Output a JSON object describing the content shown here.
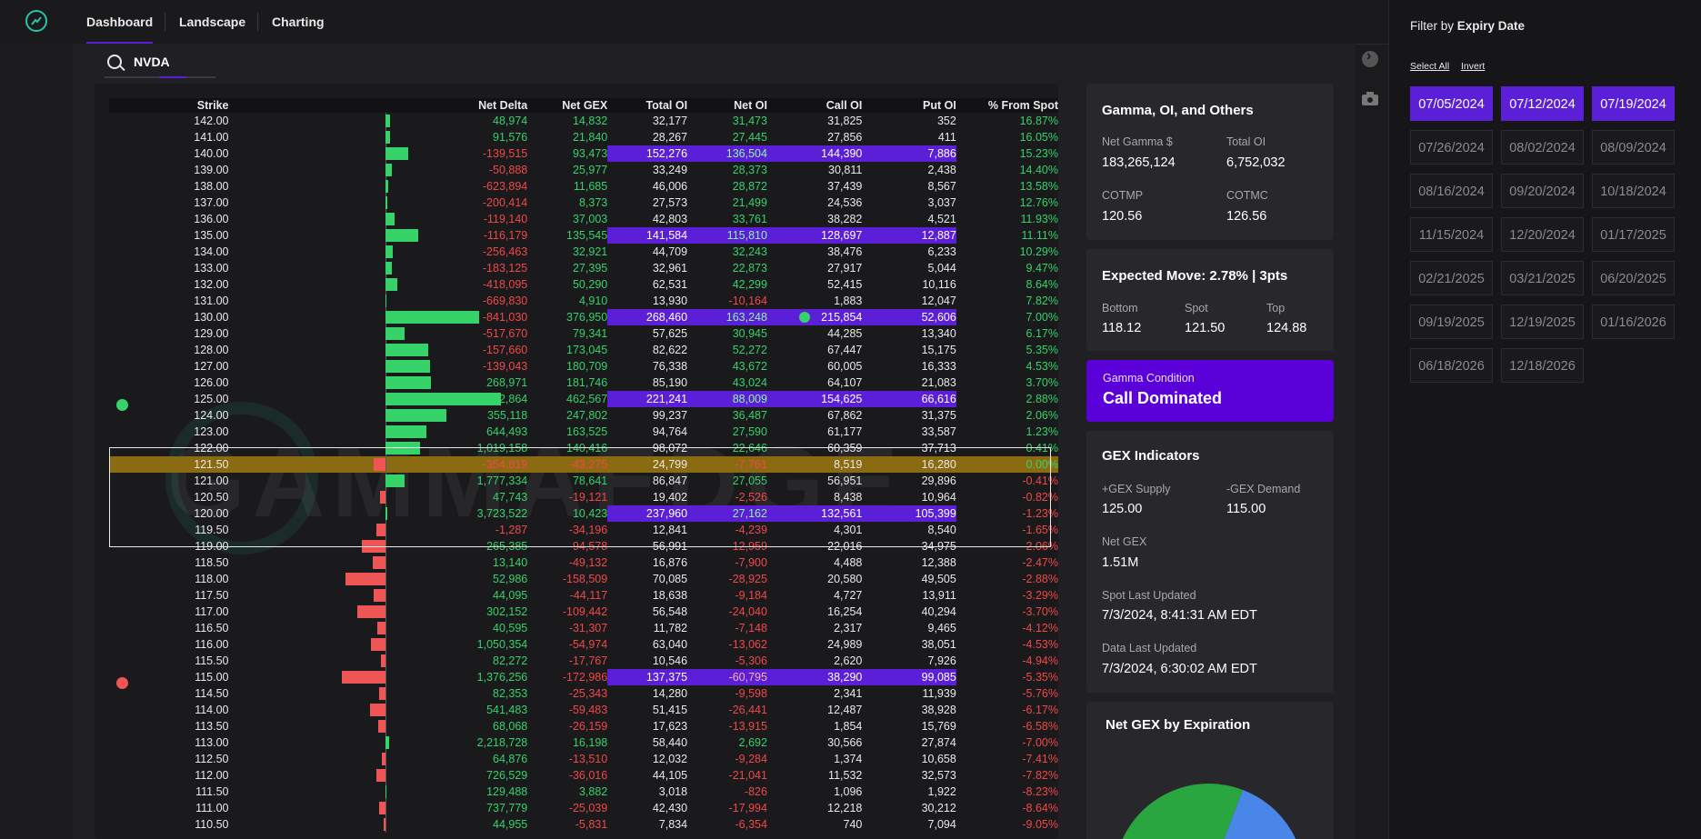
{
  "nav": {
    "tabs": [
      "Dashboard",
      "Landscape",
      "Charting"
    ]
  },
  "search": {
    "value": "NVDA"
  },
  "table": {
    "headers": [
      "Strike",
      "Net Delta",
      "Net GEX",
      "Total OI",
      "Net OI",
      "Call OI",
      "Put OI",
      "% From Spot"
    ],
    "rows": [
      {
        "strike": "142.00",
        "nd": "48,974",
        "ng": "14,832",
        "toi": "32,177",
        "noi": "31,473",
        "coi": "31,825",
        "poi": "352",
        "pct": "16.87%",
        "bar": 0.04,
        "hl": false
      },
      {
        "strike": "141.00",
        "nd": "91,576",
        "ng": "21,840",
        "toi": "28,267",
        "noi": "27,445",
        "coi": "27,856",
        "poi": "411",
        "pct": "16.05%",
        "bar": 0.045,
        "hl": false
      },
      {
        "strike": "140.00",
        "nd": "-139,515",
        "ng": "93,473",
        "toi": "152,276",
        "noi": "136,504",
        "coi": "144,390",
        "poi": "7,886",
        "pct": "15.23%",
        "bar": 0.2,
        "hl": true
      },
      {
        "strike": "139.00",
        "nd": "-50,888",
        "ng": "25,977",
        "toi": "33,249",
        "noi": "28,373",
        "coi": "30,811",
        "poi": "2,438",
        "pct": "14.40%",
        "bar": 0.055,
        "hl": false
      },
      {
        "strike": "138.00",
        "nd": "-623,894",
        "ng": "11,685",
        "toi": "46,006",
        "noi": "28,872",
        "coi": "37,439",
        "poi": "8,567",
        "pct": "13.58%",
        "bar": 0.025,
        "hl": false
      },
      {
        "strike": "137.00",
        "nd": "-200,414",
        "ng": "8,373",
        "toi": "27,573",
        "noi": "21,499",
        "coi": "24,536",
        "poi": "3,037",
        "pct": "12.76%",
        "bar": 0.018,
        "hl": false
      },
      {
        "strike": "136.00",
        "nd": "-119,140",
        "ng": "37,003",
        "toi": "42,803",
        "noi": "33,761",
        "coi": "38,282",
        "poi": "4,521",
        "pct": "11.93%",
        "bar": 0.08,
        "hl": false
      },
      {
        "strike": "135.00",
        "nd": "-116,179",
        "ng": "135,545",
        "toi": "141,584",
        "noi": "115,810",
        "coi": "128,697",
        "poi": "12,887",
        "pct": "11.11%",
        "bar": 0.29,
        "hl": true
      },
      {
        "strike": "134.00",
        "nd": "-256,463",
        "ng": "32,921",
        "toi": "44,709",
        "noi": "32,243",
        "coi": "38,476",
        "poi": "6,233",
        "pct": "10.29%",
        "bar": 0.07,
        "hl": false
      },
      {
        "strike": "133.00",
        "nd": "-183,125",
        "ng": "27,395",
        "toi": "32,961",
        "noi": "22,873",
        "coi": "27,917",
        "poi": "5,044",
        "pct": "9.47%",
        "bar": 0.06,
        "hl": false
      },
      {
        "strike": "132.00",
        "nd": "-418,095",
        "ng": "50,290",
        "toi": "62,531",
        "noi": "42,299",
        "coi": "52,415",
        "poi": "10,116",
        "pct": "8.64%",
        "bar": 0.11,
        "hl": false
      },
      {
        "strike": "131.00",
        "nd": "-669,830",
        "ng": "4,910",
        "toi": "13,930",
        "noi": "-10,164",
        "coi": "1,883",
        "poi": "12,047",
        "pct": "7.82%",
        "bar": 0.012,
        "hl": false
      },
      {
        "strike": "130.00",
        "nd": "-841,030",
        "ng": "376,950",
        "toi": "268,460",
        "noi": "163,248",
        "coi": "215,854",
        "poi": "52,606",
        "pct": "7.00%",
        "bar": 0.815,
        "hl": true,
        "calldot": true
      },
      {
        "strike": "129.00",
        "nd": "-517,670",
        "ng": "79,341",
        "toi": "57,625",
        "noi": "30,945",
        "coi": "44,285",
        "poi": "13,340",
        "pct": "6.17%",
        "bar": 0.17,
        "hl": false
      },
      {
        "strike": "128.00",
        "nd": "-157,660",
        "ng": "173,045",
        "toi": "82,622",
        "noi": "52,272",
        "coi": "67,447",
        "poi": "15,175",
        "pct": "5.35%",
        "bar": 0.375,
        "hl": false
      },
      {
        "strike": "127.00",
        "nd": "-139,043",
        "ng": "180,709",
        "toi": "76,338",
        "noi": "43,672",
        "coi": "60,005",
        "poi": "16,333",
        "pct": "4.53%",
        "bar": 0.39,
        "hl": false
      },
      {
        "strike": "126.00",
        "nd": "268,971",
        "ng": "181,746",
        "toi": "85,190",
        "noi": "43,024",
        "coi": "64,107",
        "poi": "21,083",
        "pct": "3.70%",
        "bar": 0.395,
        "hl": false
      },
      {
        "strike": "125.00",
        "nd": "452,864",
        "ng": "462,567",
        "toi": "221,241",
        "noi": "88,009",
        "coi": "154,625",
        "poi": "66,616",
        "pct": "2.88%",
        "bar": 1.0,
        "hl": true,
        "leftdot": "green"
      },
      {
        "strike": "124.00",
        "nd": "355,118",
        "ng": "247,802",
        "toi": "99,237",
        "noi": "36,487",
        "coi": "67,862",
        "poi": "31,375",
        "pct": "2.06%",
        "bar": 0.535,
        "hl": false
      },
      {
        "strike": "123.00",
        "nd": "644,493",
        "ng": "163,525",
        "toi": "94,764",
        "noi": "27,590",
        "coi": "61,177",
        "poi": "33,587",
        "pct": "1.23%",
        "bar": 0.355,
        "hl": false
      },
      {
        "strike": "122.00",
        "nd": "1,019,158",
        "ng": "140,416",
        "toi": "98,072",
        "noi": "22,646",
        "coi": "60,359",
        "poi": "37,713",
        "pct": "0.41%",
        "bar": 0.305,
        "hl": false
      },
      {
        "strike": "121.50",
        "nd": "-354,819",
        "ng": "-43,275",
        "toi": "24,799",
        "noi": "-7,761",
        "coi": "8,519",
        "poi": "16,280",
        "pct": "0.00%",
        "bar": -0.095,
        "hl": false,
        "spot": true
      },
      {
        "strike": "121.00",
        "nd": "1,777,334",
        "ng": "78,641",
        "toi": "86,847",
        "noi": "27,055",
        "coi": "56,951",
        "poi": "29,896",
        "pct": "-0.41%",
        "bar": 0.17,
        "hl": false
      },
      {
        "strike": "120.50",
        "nd": "47,743",
        "ng": "-19,121",
        "toi": "19,402",
        "noi": "-2,526",
        "coi": "8,438",
        "poi": "10,964",
        "pct": "-0.82%",
        "bar": -0.04,
        "hl": false
      },
      {
        "strike": "120.00",
        "nd": "3,723,522",
        "ng": "10,423",
        "toi": "237,960",
        "noi": "27,162",
        "coi": "132,561",
        "poi": "105,399",
        "pct": "-1.23%",
        "bar": 0.022,
        "hl": true
      },
      {
        "strike": "119.50",
        "nd": "-1,287",
        "ng": "-34,196",
        "toi": "12,841",
        "noi": "-4,239",
        "coi": "4,301",
        "poi": "8,540",
        "pct": "-1.65%",
        "bar": -0.074,
        "hl": false
      },
      {
        "strike": "119.00",
        "nd": "265,385",
        "ng": "-94,578",
        "toi": "56,991",
        "noi": "-12,959",
        "coi": "22,016",
        "poi": "34,975",
        "pct": "-2.06%",
        "bar": -0.204,
        "hl": false
      },
      {
        "strike": "118.50",
        "nd": "13,140",
        "ng": "-49,132",
        "toi": "16,876",
        "noi": "-7,900",
        "coi": "4,488",
        "poi": "12,388",
        "pct": "-2.47%",
        "bar": -0.106,
        "hl": false
      },
      {
        "strike": "118.00",
        "nd": "52,986",
        "ng": "-158,509",
        "toi": "70,085",
        "noi": "-28,925",
        "coi": "20,580",
        "poi": "49,505",
        "pct": "-2.88%",
        "bar": -0.343,
        "hl": false
      },
      {
        "strike": "117.50",
        "nd": "44,095",
        "ng": "-44,117",
        "toi": "18,638",
        "noi": "-9,184",
        "coi": "4,727",
        "poi": "13,911",
        "pct": "-3.29%",
        "bar": -0.095,
        "hl": false
      },
      {
        "strike": "117.00",
        "nd": "302,152",
        "ng": "-109,442",
        "toi": "56,548",
        "noi": "-24,040",
        "coi": "16,254",
        "poi": "40,294",
        "pct": "-3.70%",
        "bar": -0.237,
        "hl": false
      },
      {
        "strike": "116.50",
        "nd": "40,595",
        "ng": "-31,307",
        "toi": "11,782",
        "noi": "-7,148",
        "coi": "2,317",
        "poi": "9,465",
        "pct": "-4.12%",
        "bar": -0.068,
        "hl": false
      },
      {
        "strike": "116.00",
        "nd": "1,050,354",
        "ng": "-54,974",
        "toi": "63,040",
        "noi": "-13,062",
        "coi": "24,989",
        "poi": "38,051",
        "pct": "-4.53%",
        "bar": -0.119,
        "hl": false
      },
      {
        "strike": "115.50",
        "nd": "82,272",
        "ng": "-17,767",
        "toi": "10,546",
        "noi": "-5,306",
        "coi": "2,620",
        "poi": "7,926",
        "pct": "-4.94%",
        "bar": -0.038,
        "hl": false
      },
      {
        "strike": "115.00",
        "nd": "1,376,256",
        "ng": "-172,986",
        "toi": "137,375",
        "noi": "-60,795",
        "coi": "38,290",
        "poi": "99,085",
        "pct": "-5.35%",
        "bar": -0.374,
        "hl": true,
        "leftdot": "red"
      },
      {
        "strike": "114.50",
        "nd": "82,353",
        "ng": "-25,343",
        "toi": "14,280",
        "noi": "-9,598",
        "coi": "2,341",
        "poi": "11,939",
        "pct": "-5.76%",
        "bar": -0.055,
        "hl": false
      },
      {
        "strike": "114.00",
        "nd": "541,483",
        "ng": "-59,483",
        "toi": "51,415",
        "noi": "-26,441",
        "coi": "12,487",
        "poi": "38,928",
        "pct": "-6.17%",
        "bar": -0.129,
        "hl": false
      },
      {
        "strike": "113.50",
        "nd": "68,068",
        "ng": "-26,159",
        "toi": "17,623",
        "noi": "-13,915",
        "coi": "1,854",
        "poi": "15,769",
        "pct": "-6.58%",
        "bar": -0.057,
        "hl": false
      },
      {
        "strike": "113.00",
        "nd": "2,218,728",
        "ng": "16,198",
        "toi": "58,440",
        "noi": "2,692",
        "coi": "30,566",
        "poi": "27,874",
        "pct": "-7.00%",
        "bar": 0.035,
        "hl": false
      },
      {
        "strike": "112.50",
        "nd": "64,876",
        "ng": "-13,510",
        "toi": "12,032",
        "noi": "-9,284",
        "coi": "1,374",
        "poi": "10,658",
        "pct": "-7.41%",
        "bar": -0.029,
        "hl": false
      },
      {
        "strike": "112.00",
        "nd": "726,529",
        "ng": "-36,016",
        "toi": "44,105",
        "noi": "-21,041",
        "coi": "11,532",
        "poi": "32,573",
        "pct": "-7.82%",
        "bar": -0.078,
        "hl": false
      },
      {
        "strike": "111.50",
        "nd": "129,488",
        "ng": "3,882",
        "toi": "3,018",
        "noi": "-826",
        "coi": "1,096",
        "poi": "1,922",
        "pct": "-8.23%",
        "bar": 0.008,
        "hl": false
      },
      {
        "strike": "111.00",
        "nd": "737,779",
        "ng": "-25,039",
        "toi": "42,430",
        "noi": "-17,994",
        "coi": "12,218",
        "poi": "30,212",
        "pct": "-8.64%",
        "bar": -0.054,
        "hl": false
      },
      {
        "strike": "110.50",
        "nd": "44,955",
        "ng": "-5,831",
        "toi": "7,834",
        "noi": "-6,354",
        "coi": "740",
        "poi": "7,094",
        "pct": "-9.05%",
        "bar": -0.013,
        "hl": false
      }
    ]
  },
  "watermark": "GAMMAEDGE",
  "cards": {
    "gamma": {
      "title": "Gamma, OI, and Others",
      "net_gamma_label": "Net Gamma $",
      "net_gamma": "183,265,124",
      "total_oi_label": "Total OI",
      "total_oi": "6,752,032",
      "cotmp_label": "COTMP",
      "cotmp": "120.56",
      "cotmc_label": "COTMC",
      "cotmc": "126.56"
    },
    "move": {
      "title": "Expected Move: 2.78% | 3pts",
      "bottom_label": "Bottom",
      "bottom": "118.12",
      "spot_label": "Spot",
      "spot": "121.50",
      "top_label": "Top",
      "top": "124.88"
    },
    "condition": {
      "label": "Gamma Condition",
      "value": "Call Dominated"
    },
    "gex": {
      "title": "GEX Indicators",
      "supply_label": "+GEX Supply",
      "supply": "125.00",
      "demand_label": "-GEX Demand",
      "demand": "115.00",
      "netgex_label": "Net GEX",
      "netgex": "1.51M",
      "spot_updated_label": "Spot Last Updated",
      "spot_updated": "7/3/2024, 8:41:31 AM EDT",
      "data_updated_label": "Data Last Updated",
      "data_updated": "7/3/2024, 6:30:02 AM EDT"
    },
    "pie": {
      "title": "Net GEX by Expiration"
    }
  },
  "filter": {
    "title_prefix": "Filter by ",
    "title_bold": "Expiry Date",
    "select_all": "Select All",
    "invert": "Invert",
    "dates": [
      {
        "d": "07/05/2024",
        "sel": true
      },
      {
        "d": "07/12/2024",
        "sel": true
      },
      {
        "d": "07/19/2024",
        "sel": true
      },
      {
        "d": "07/26/2024",
        "sel": false
      },
      {
        "d": "08/02/2024",
        "sel": false
      },
      {
        "d": "08/09/2024",
        "sel": false
      },
      {
        "d": "08/16/2024",
        "sel": false
      },
      {
        "d": "09/20/2024",
        "sel": false
      },
      {
        "d": "10/18/2024",
        "sel": false
      },
      {
        "d": "11/15/2024",
        "sel": false
      },
      {
        "d": "12/20/2024",
        "sel": false
      },
      {
        "d": "01/17/2025",
        "sel": false
      },
      {
        "d": "02/21/2025",
        "sel": false
      },
      {
        "d": "03/21/2025",
        "sel": false
      },
      {
        "d": "06/20/2025",
        "sel": false
      },
      {
        "d": "09/19/2025",
        "sel": false
      },
      {
        "d": "12/19/2025",
        "sel": false
      },
      {
        "d": "01/16/2026",
        "sel": false
      },
      {
        "d": "06/18/2026",
        "sel": false
      },
      {
        "d": "12/18/2026",
        "sel": false
      }
    ]
  },
  "colors": {
    "accent": "#5a1fd6",
    "positive": "#36d26a",
    "negative": "#f04848",
    "spot_row": "#8a6b12"
  }
}
